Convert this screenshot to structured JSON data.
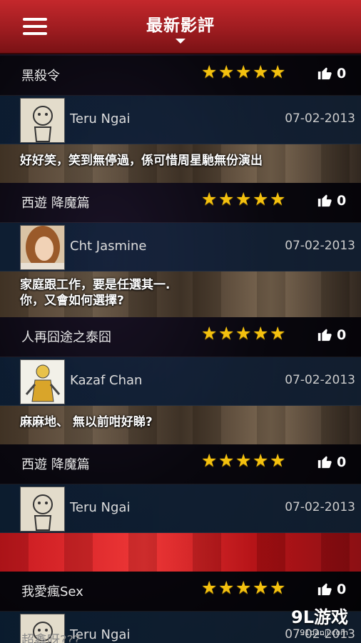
{
  "header": {
    "title": "最新影評"
  },
  "reviews": [
    {
      "movie": "黑殺令",
      "rating": 5,
      "likes": "0",
      "user": "Teru Ngai",
      "avatar": "doodle-avatar",
      "date": "07-02-2013",
      "comment": "好好笑，笑到無停過，係可惜周星馳無份演出"
    },
    {
      "movie": "西遊 降魔篇",
      "rating": 5,
      "likes": "0",
      "user": "Cht Jasmine",
      "avatar": "woman-photo-avatar",
      "date": "07-02-2013",
      "comment": "家庭跟工作，要是任選其一.\n你，又會如何選擇?"
    },
    {
      "movie": "人再囧途之泰囧",
      "rating": 5,
      "likes": "0",
      "user": "Kazaf Chan",
      "avatar": "cartoon-figure-avatar",
      "date": "07-02-2013",
      "comment": "麻麻地、 無以前咁好睇?"
    },
    {
      "movie": "西遊 降魔篇",
      "rating": 5,
      "likes": "0",
      "user": "Teru Ngai",
      "avatar": "doodle-avatar",
      "date": "07-02-2013",
      "comment": ""
    },
    {
      "movie": "我愛瘋Sex",
      "rating": 5,
      "likes": "0",
      "user": "Teru Ngai",
      "avatar": "doodle-avatar",
      "date": "07-02-2013",
      "comment": ""
    }
  ],
  "next_partial_title": "超鑫呀???",
  "watermark": {
    "logo": "9L游戏",
    "url": "91danji.com"
  },
  "colors": {
    "header": "#b2232a",
    "star": "#f4c10f"
  }
}
